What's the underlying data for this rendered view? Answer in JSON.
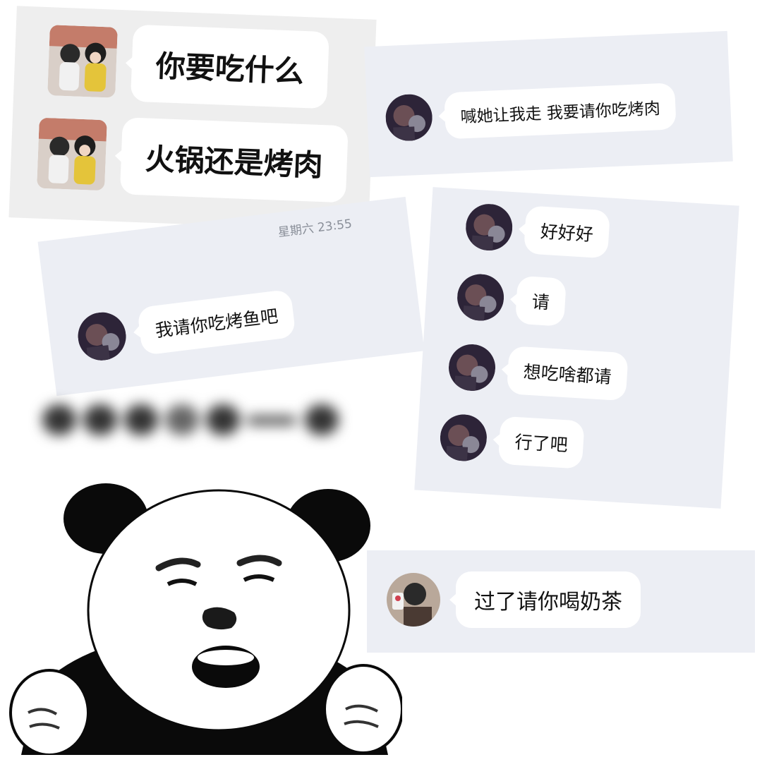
{
  "panel_top_left": {
    "messages": [
      {
        "text": "你要吃什么"
      },
      {
        "text": "火锅还是烤肉"
      }
    ]
  },
  "panel_top_right": {
    "messages": [
      {
        "text": "喊她让我走 我要请你吃烤肉"
      }
    ]
  },
  "panel_mid_left": {
    "timestamp": "星期六 23:55",
    "messages": [
      {
        "text": "我请你吃烤鱼吧"
      }
    ]
  },
  "panel_right": {
    "messages": [
      {
        "text": "好好好"
      },
      {
        "text": "请"
      },
      {
        "text": "想吃啥都请"
      },
      {
        "text": "行了吧"
      }
    ]
  },
  "panel_bottom_right": {
    "messages": [
      {
        "text": "过了请你喝奶茶"
      }
    ]
  },
  "meme": {
    "icon": "panda-meme-sticker-icon"
  },
  "colors": {
    "panel_background": "#eceef4",
    "bubble_background": "#ffffff",
    "text": "#111111",
    "timestamp": "#8a8f99"
  }
}
